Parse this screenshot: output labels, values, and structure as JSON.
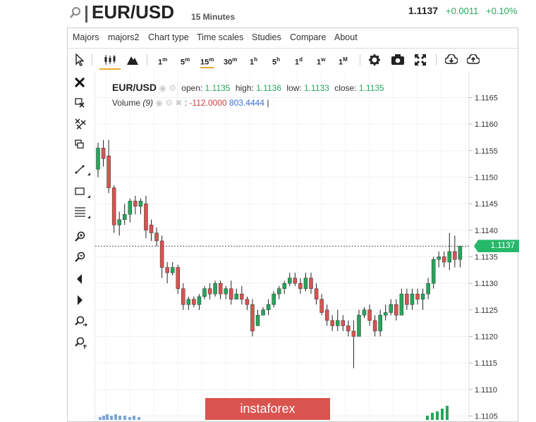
{
  "header": {
    "symbol": "EUR/USD",
    "timeframe": "15 Minutes",
    "last_price": "1.1137",
    "change": "+0.0011",
    "change_pct": "+0.10%"
  },
  "menu": [
    "Majors",
    "majors2",
    "Chart type",
    "Time scales",
    "Studies",
    "Compare",
    "About"
  ],
  "toolbar": {
    "intervals": [
      {
        "n": "1",
        "u": "m"
      },
      {
        "n": "5",
        "u": "m"
      },
      {
        "n": "15",
        "u": "m"
      },
      {
        "n": "30",
        "u": "m"
      },
      {
        "n": "1",
        "u": "h"
      },
      {
        "n": "5",
        "u": "h"
      },
      {
        "n": "1",
        "u": "d"
      },
      {
        "n": "1",
        "u": "w"
      },
      {
        "n": "1",
        "u": "M"
      }
    ],
    "selected_interval": "15m",
    "icons": [
      "cursor-icon",
      "candles-icon",
      "mountain-icon",
      "gear-icon",
      "camera-icon",
      "fullscreen-icon",
      "download-icon",
      "upload-icon"
    ]
  },
  "sidebar_icons": [
    "close-icon",
    "delete-drawing-icon",
    "delete-all-icon",
    "clone-icon",
    "trendline-icon",
    "rectangle-icon",
    "fib-levels-icon",
    "zoom-in-icon",
    "zoom-out-icon",
    "scroll-left-icon",
    "scroll-right-icon",
    "zoom-reset-icon",
    "zoom-fit-icon"
  ],
  "legend": {
    "symbol": "EUR/USD",
    "open_label": "open:",
    "open": "1.1135",
    "high_label": "high:",
    "high": "1.1136",
    "low_label": "low:",
    "low": "1.1133",
    "close_label": "close:",
    "close": "1.1135",
    "volume_label": "Volume",
    "volume_period": "(9)",
    "volume_sep": ":",
    "volume_neg": "-112.0000",
    "volume_pos": "803.4444",
    "volume_cursor": "|"
  },
  "axis": {
    "ticks": [
      "1.1165",
      "1.1160",
      "1.1155",
      "1.1150",
      "1.1145",
      "1.1140",
      "1.1135",
      "1.1130",
      "1.1125",
      "1.1120",
      "1.1115",
      "1.1110",
      "1.1105"
    ],
    "current_price_label": "1.1137"
  },
  "watermark": "instaforex",
  "colors": {
    "up": "#26a65b",
    "down": "#d9534f",
    "accent": "#e8a92b",
    "badge": "#26b86a"
  },
  "chart_data": {
    "type": "candlestick",
    "ylim": [
      1.1104,
      1.1168
    ],
    "yticks": [
      1.1165,
      1.116,
      1.1155,
      1.115,
      1.1145,
      1.114,
      1.1135,
      1.113,
      1.1125,
      1.112,
      1.1115,
      1.111,
      1.1105
    ],
    "current_price": 1.1137,
    "candles": [
      [
        1.11515,
        1.11555,
        1.11565,
        1.115
      ],
      [
        1.11555,
        1.11535,
        1.1157,
        1.1152
      ],
      [
        1.1154,
        1.1148,
        1.1157,
        1.1147
      ],
      [
        1.1148,
        1.1141,
        1.11485,
        1.11395
      ],
      [
        1.1141,
        1.1142,
        1.11435,
        1.1139
      ],
      [
        1.1142,
        1.1143,
        1.1145,
        1.1141
      ],
      [
        1.1143,
        1.11455,
        1.1146,
        1.11415
      ],
      [
        1.11455,
        1.11445,
        1.11465,
        1.1143
      ],
      [
        1.11445,
        1.11455,
        1.1146,
        1.1143
      ],
      [
        1.1145,
        1.114,
        1.11465,
        1.11385
      ],
      [
        1.1141,
        1.11395,
        1.1142,
        1.1138
      ],
      [
        1.11395,
        1.1138,
        1.11405,
        1.1137
      ],
      [
        1.1138,
        1.1133,
        1.1139,
        1.1131
      ],
      [
        1.1133,
        1.1132,
        1.1134,
        1.113
      ],
      [
        1.1132,
        1.1133,
        1.1134,
        1.11315
      ],
      [
        1.1133,
        1.1129,
        1.11335,
        1.1128
      ],
      [
        1.1129,
        1.1126,
        1.113,
        1.1125
      ],
      [
        1.1126,
        1.1127,
        1.11275,
        1.1125
      ],
      [
        1.1127,
        1.1126,
        1.11275,
        1.11255
      ],
      [
        1.1126,
        1.11275,
        1.1128,
        1.1125
      ],
      [
        1.11275,
        1.1129,
        1.11295,
        1.1127
      ],
      [
        1.1129,
        1.1128,
        1.113,
        1.1127
      ],
      [
        1.1128,
        1.113,
        1.11305,
        1.11275
      ],
      [
        1.113,
        1.1128,
        1.11305,
        1.1127
      ],
      [
        1.1128,
        1.1129,
        1.11295,
        1.1127
      ],
      [
        1.1129,
        1.1127,
        1.11305,
        1.1126
      ],
      [
        1.1127,
        1.1128,
        1.1129,
        1.1127
      ],
      [
        1.1128,
        1.1127,
        1.11295,
        1.1126
      ],
      [
        1.1127,
        1.1126,
        1.11275,
        1.1125
      ],
      [
        1.1126,
        1.1121,
        1.1127,
        1.112
      ],
      [
        1.1122,
        1.1124,
        1.1125,
        1.1122
      ],
      [
        1.1124,
        1.1125,
        1.11255,
        1.1124
      ],
      [
        1.1125,
        1.1126,
        1.1127,
        1.1124
      ],
      [
        1.1126,
        1.1128,
        1.11285,
        1.11255
      ],
      [
        1.1128,
        1.1129,
        1.11295,
        1.1127
      ],
      [
        1.1129,
        1.113,
        1.11305,
        1.1128
      ],
      [
        1.113,
        1.1131,
        1.1132,
        1.11295
      ],
      [
        1.1131,
        1.113,
        1.1132,
        1.11295
      ],
      [
        1.113,
        1.1129,
        1.1131,
        1.1128
      ],
      [
        1.1129,
        1.1131,
        1.1132,
        1.11285
      ],
      [
        1.1131,
        1.1129,
        1.1132,
        1.1128
      ],
      [
        1.1129,
        1.1127,
        1.113,
        1.1126
      ],
      [
        1.1127,
        1.11245,
        1.1128,
        1.1124
      ],
      [
        1.1125,
        1.1123,
        1.1126,
        1.1122
      ],
      [
        1.1123,
        1.1122,
        1.1124,
        1.1121
      ],
      [
        1.1122,
        1.1123,
        1.1125,
        1.1121
      ],
      [
        1.1123,
        1.1122,
        1.1124,
        1.1121
      ],
      [
        1.1122,
        1.1121,
        1.1123,
        1.112
      ],
      [
        1.1121,
        1.112,
        1.1123,
        1.1114
      ],
      [
        1.112,
        1.1124,
        1.1125,
        1.112
      ],
      [
        1.1124,
        1.1125,
        1.11255,
        1.11235
      ],
      [
        1.1125,
        1.1123,
        1.1126,
        1.1122
      ],
      [
        1.1123,
        1.1121,
        1.1124,
        1.112
      ],
      [
        1.1121,
        1.1124,
        1.1125,
        1.112
      ],
      [
        1.1124,
        1.11245,
        1.1126,
        1.1123
      ],
      [
        1.11245,
        1.1126,
        1.1127,
        1.1124
      ],
      [
        1.1126,
        1.1124,
        1.1127,
        1.1123
      ],
      [
        1.1124,
        1.1128,
        1.1129,
        1.1124
      ],
      [
        1.1128,
        1.1126,
        1.1129,
        1.1125
      ],
      [
        1.1126,
        1.1128,
        1.1129,
        1.1125
      ],
      [
        1.1128,
        1.1127,
        1.1129,
        1.1126
      ],
      [
        1.1127,
        1.1128,
        1.1129,
        1.1125
      ],
      [
        1.1128,
        1.113,
        1.1131,
        1.1127
      ],
      [
        1.113,
        1.11345,
        1.1135,
        1.1129
      ],
      [
        1.11345,
        1.1135,
        1.1136,
        1.1133
      ],
      [
        1.1135,
        1.1134,
        1.1136,
        1.1133
      ],
      [
        1.1134,
        1.1136,
        1.11395,
        1.11325
      ],
      [
        1.1136,
        1.11345,
        1.1139,
        1.1133
      ],
      [
        1.11345,
        1.1137,
        1.1137,
        1.1133
      ]
    ]
  }
}
